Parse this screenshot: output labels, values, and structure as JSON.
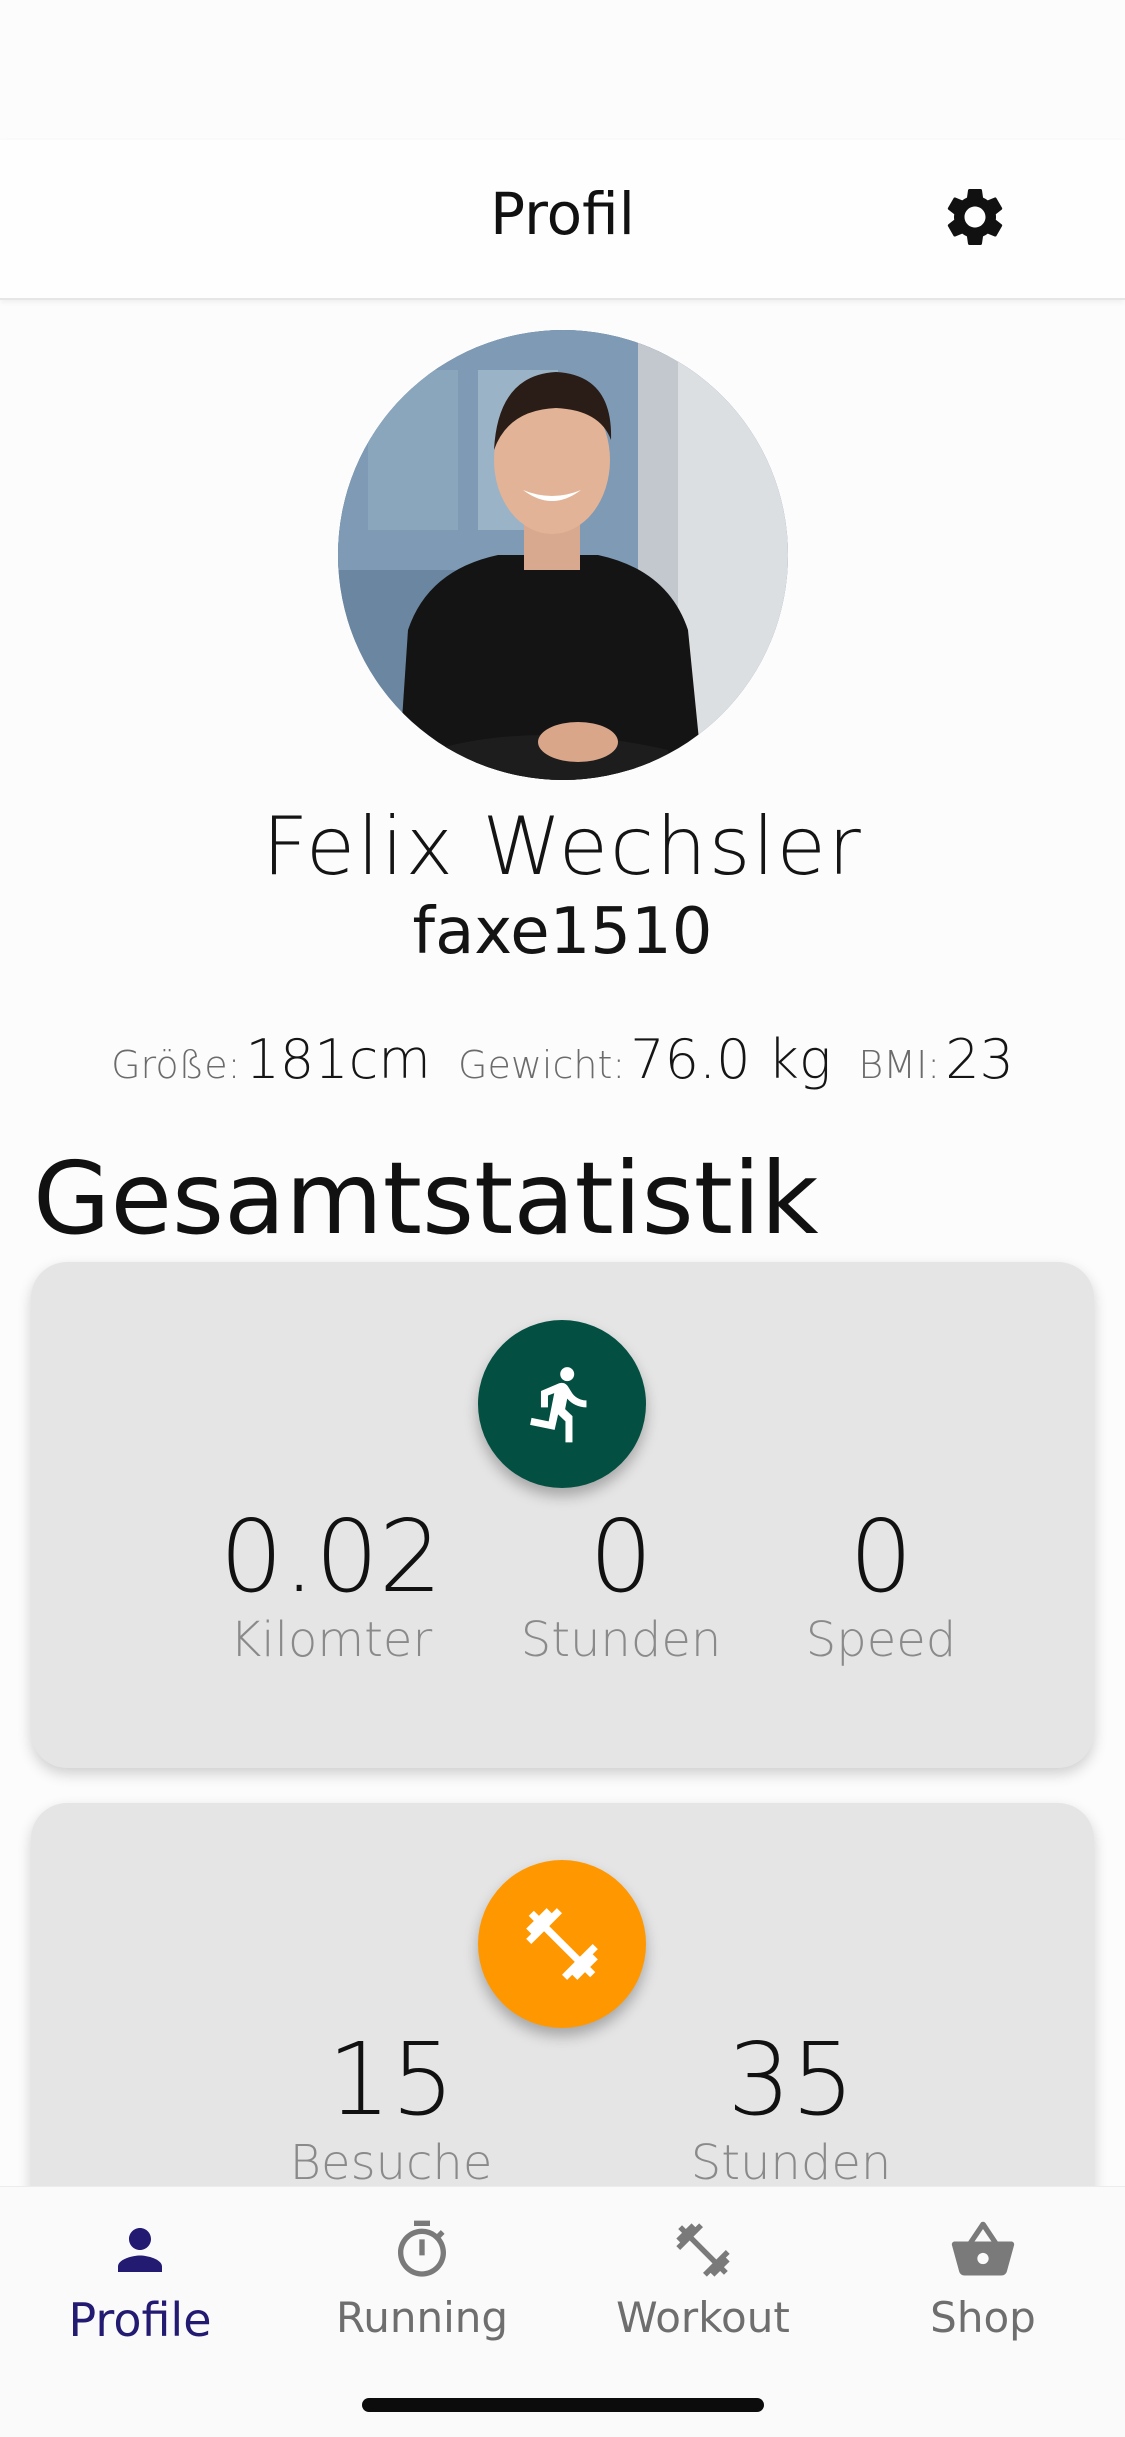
{
  "header": {
    "title": "Profil",
    "settings_icon": "gear-icon"
  },
  "profile": {
    "name": "Felix Wechsler",
    "username": "faxe1510",
    "metrics": [
      {
        "label": "Größe:",
        "value": "181cm"
      },
      {
        "label": "Gewicht:",
        "value": "76.0 kg"
      },
      {
        "label": "BMI:",
        "value": "23"
      }
    ]
  },
  "stats": {
    "title": "Gesamtstatistik",
    "running": {
      "icon": "running-person-icon",
      "color": "#035043",
      "items": [
        {
          "value": "0.02",
          "label": "Kilomter"
        },
        {
          "value": "0",
          "label": "Stunden"
        },
        {
          "value": "0",
          "label": "Speed"
        }
      ]
    },
    "workout": {
      "icon": "dumbbell-icon",
      "color": "#FF9800",
      "items": [
        {
          "value": "15",
          "label": "Besuche"
        },
        {
          "value": "35",
          "label": "Stunden"
        }
      ]
    }
  },
  "tabbar": {
    "active_color": "#231A72",
    "tabs": [
      {
        "label": "Profile",
        "icon": "person-icon",
        "active": true
      },
      {
        "label": "Running",
        "icon": "stopwatch-icon",
        "active": false
      },
      {
        "label": "Workout",
        "icon": "dumbbell-icon",
        "active": false
      },
      {
        "label": "Shop",
        "icon": "basket-icon",
        "active": false
      }
    ]
  }
}
